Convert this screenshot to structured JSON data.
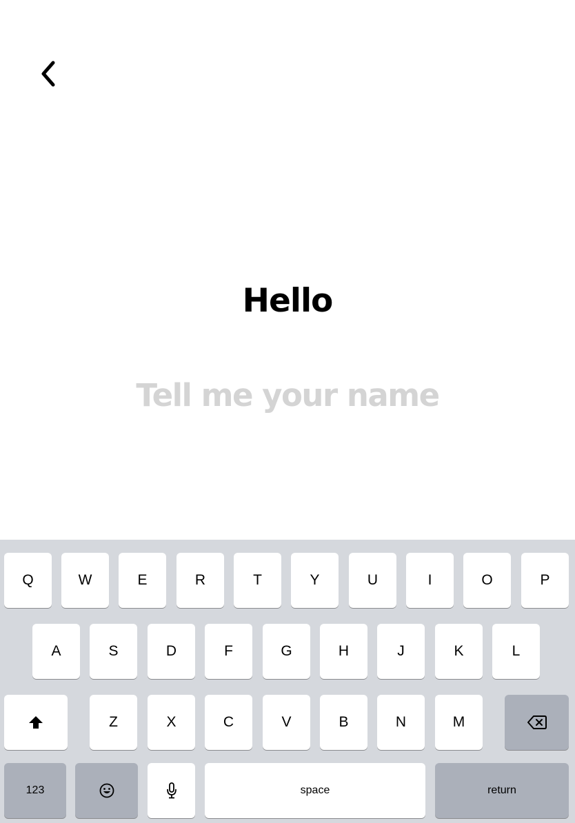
{
  "screen": {
    "greeting": "Hello",
    "name_placeholder": "Tell me your name",
    "name_value": ""
  },
  "keyboard": {
    "row1": [
      "Q",
      "W",
      "E",
      "R",
      "T",
      "Y",
      "U",
      "I",
      "O",
      "P"
    ],
    "row2": [
      "A",
      "S",
      "D",
      "F",
      "G",
      "H",
      "J",
      "K",
      "L"
    ],
    "row3": [
      "Z",
      "X",
      "C",
      "V",
      "B",
      "N",
      "M"
    ],
    "numbers_label": "123",
    "space_label": "space",
    "return_label": "return"
  },
  "icons": {
    "back": "chevron-left-icon",
    "shift": "shift-arrow-icon",
    "backspace": "backspace-icon",
    "emoji": "emoji-face-icon",
    "microphone": "microphone-icon"
  },
  "colors": {
    "keyboard_background": "#d5d8dd",
    "letter_key": "#ffffff",
    "function_key": "#abb0ba",
    "placeholder": "#d4d4d4"
  }
}
